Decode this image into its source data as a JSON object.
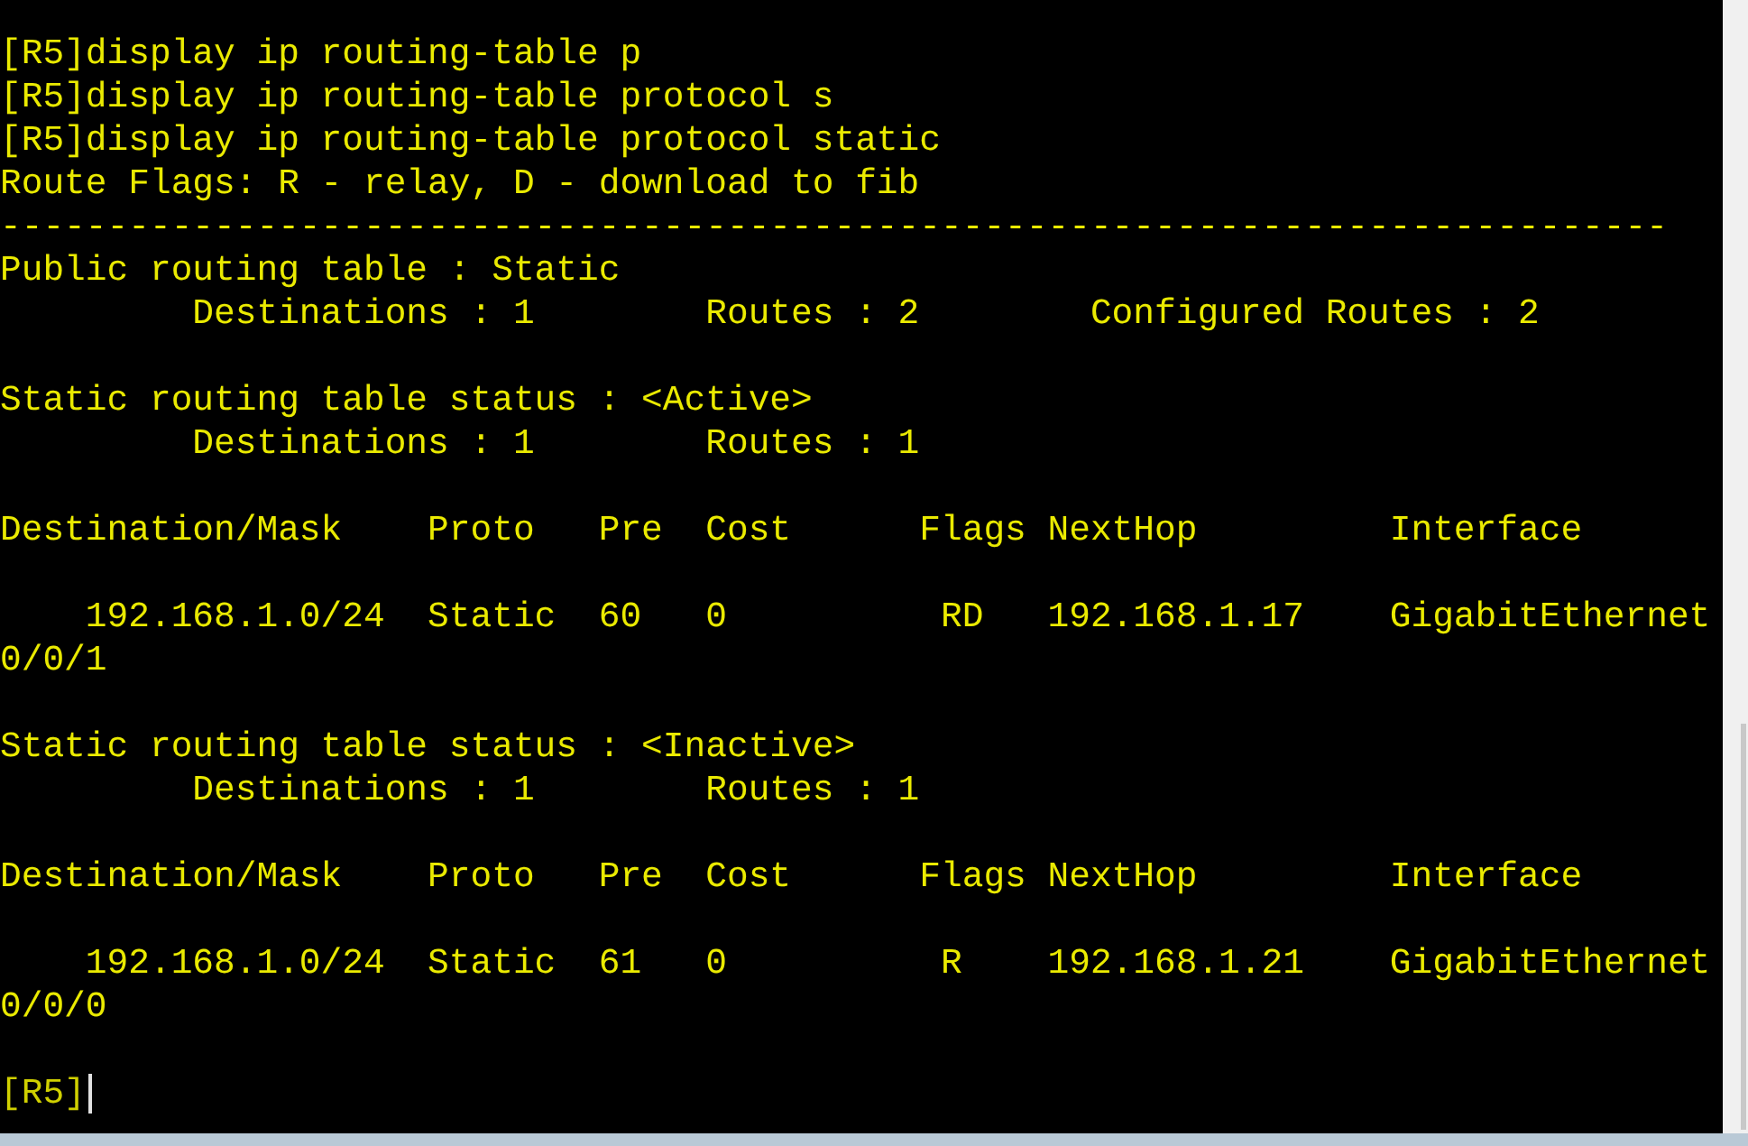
{
  "terminal": {
    "blocks": [
      [
        "[R5]display ip routing-table p",
        "[R5]display ip routing-table protocol s",
        "[R5]display ip routing-table protocol static",
        "Route Flags: R - relay, D - download to fib",
        "------------------------------------------------------------------------------",
        "Public routing table : Static",
        "         Destinations : 1        Routes : 2        Configured Routes : 2"
      ],
      [
        "Static routing table status : <Active>",
        "         Destinations : 1        Routes : 1"
      ],
      [
        "Destination/Mask    Proto   Pre  Cost      Flags NextHop         Interface"
      ],
      [
        "    192.168.1.0/24  Static  60   0          RD   192.168.1.17    GigabitEthernet",
        "0/0/1"
      ],
      [
        "Static routing table status : <Inactive>",
        "         Destinations : 1        Routes : 1"
      ],
      [
        "Destination/Mask    Proto   Pre  Cost      Flags NextHop         Interface"
      ],
      [
        "    192.168.1.0/24  Static  61   0          R    192.168.1.21    GigabitEthernet",
        "0/0/0"
      ]
    ],
    "prompt": "[R5]",
    "cursor_visible": true
  }
}
